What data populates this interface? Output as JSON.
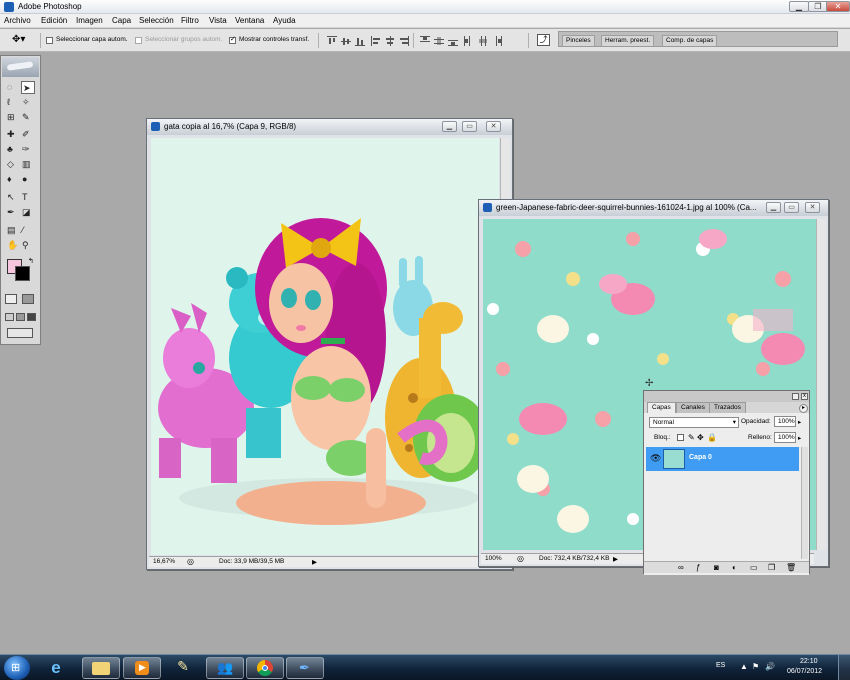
{
  "app": {
    "title": "Adobe Photoshop"
  },
  "window_controls": {
    "minimize": "▁",
    "restore": "❐",
    "close": "✕"
  },
  "menu": [
    "Archivo",
    "Edición",
    "Imagen",
    "Capa",
    "Selección",
    "Filtro",
    "Vista",
    "Ventana",
    "Ayuda"
  ],
  "options_bar": {
    "auto_select_layer": {
      "label": "Seleccionar capa autom.",
      "checked": false
    },
    "auto_select_groups": {
      "label": "Seleccionar grupos autom.",
      "checked": false,
      "disabled": true
    },
    "show_transform": {
      "label": "Mostrar controles transf.",
      "checked": true
    },
    "well_tabs": [
      "Pinceles",
      "Herram. preest.",
      "Comp. de capas"
    ]
  },
  "toolbox": {
    "tools": [
      "marquee-icon",
      "move-icon",
      "lasso-icon",
      "magic-wand-icon",
      "crop-icon",
      "slice-icon",
      "healing-brush-icon",
      "brush-icon",
      "clone-stamp-icon",
      "history-brush-icon",
      "eraser-icon",
      "gradient-icon",
      "blur-icon",
      "dodge-icon",
      "path-selection-icon",
      "type-icon",
      "pen-icon",
      "shape-icon",
      "notes-icon",
      "eyedropper-icon",
      "hand-icon",
      "zoom-icon"
    ],
    "foreground_color": "#f6c6de",
    "background_color": "#000000"
  },
  "doc1": {
    "title": "gata copia al 16,7% (Capa 9, RGB/8)",
    "zoom": "16,67%",
    "doc_size": "Doc: 33,9 MB/39,5 MB",
    "canvas_color": "#dff5ec"
  },
  "doc2": {
    "title": "green-Japanese-fabric-deer-squirrel-bunnies-161024-1.jpg al 100% (Ca...",
    "zoom": "100%",
    "doc_size": "Doc: 732,4 KB/732,4 KB",
    "canvas_color": "#8fdccb"
  },
  "layers_panel": {
    "tabs": [
      "Capas",
      "Canales",
      "Trazados"
    ],
    "active_tab": "Capas",
    "blend_mode": "Normal",
    "opacity_label": "Opacidad:",
    "opacity": "100%",
    "lock_label": "Bloq.:",
    "fill_label": "Relleno:",
    "fill": "100%",
    "layers": [
      {
        "name": "Capa 0",
        "visible": true,
        "selected": true
      }
    ]
  },
  "taskbar": {
    "apps": [
      "windows-start-icon",
      "internet-explorer-icon",
      "file-explorer-icon",
      "media-player-icon",
      "paint-icon",
      "messenger-icon",
      "chrome-icon",
      "photoshop-feather-icon"
    ],
    "language": "ES",
    "time": "22:10",
    "date": "06/07/2012"
  },
  "accent": "#3f9cf2"
}
